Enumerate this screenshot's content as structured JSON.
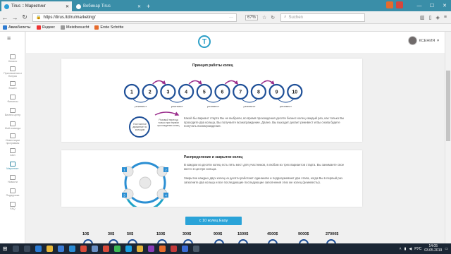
{
  "browser": {
    "tabs": [
      {
        "title": "Tirus :: Маркетинг",
        "active": true
      },
      {
        "title": "Вебинар Tirus",
        "active": false
      }
    ],
    "url": "https://tirus.ltd/ru/marketing/",
    "zoom": "67%",
    "search_placeholder": "Suchen",
    "bookmarks": [
      "Авиабилеты",
      "Яндекс",
      "Meistbesucht",
      "Erste Schritte"
    ]
  },
  "sidebar": {
    "menu_icon": "hamburger-icon",
    "items": [
      {
        "label": "Начало",
        "icon": "home-icon"
      },
      {
        "label": "Приглашения и бонусы",
        "icon": "gift-icon"
      },
      {
        "label": "Кошел",
        "icon": "wallet-icon"
      },
      {
        "label": "Финансы",
        "icon": "finance-icon"
      },
      {
        "label": "Бизнес центр",
        "icon": "business-icon"
      },
      {
        "label": "Мой команда",
        "icon": "team-icon"
      },
      {
        "label": "Инвестиции программы",
        "icon": "investment-icon"
      },
      {
        "label": "Шоп",
        "icon": "shop-icon"
      },
      {
        "label": "Маркетинг",
        "icon": "marketing-icon",
        "active": true
      },
      {
        "label": "Новости",
        "icon": "news-icon"
      },
      {
        "label": "Поддержка",
        "icon": "support-icon"
      },
      {
        "label": "FAQ",
        "icon": "faq-icon"
      }
    ]
  },
  "header": {
    "username": "КСЕНИЯ"
  },
  "section1": {
    "title": "Принцип работы колец",
    "rings": [
      "1",
      "2",
      "3",
      "4",
      "5",
      "6",
      "7",
      "8",
      "9",
      "10"
    ],
    "reinvest_label": "реинвест",
    "legend_rotation": "Постоянное движение по кольцам",
    "legend_transfer": "Разовый переход только при первом прохождении колец",
    "paragraph": "Какой бы вариант старта Вы не выбрали, во время прохождения десяти бизнес колец каждый раз, как только Вы проходите два кольца, Вы получаете вознаграждение. Далее, Вы выходит делает реинвест и Вы снова будете получать вознаграждение."
  },
  "section2": {
    "title": "Распределение и закрытие колец",
    "nodes": [
      "1",
      "2",
      "3",
      "4"
    ],
    "paragraph1": "В каждом из десяти колец есть пять мест для участников, в любом из трех вариантов старта. Вы занимаете свое место в центре кольца.",
    "paragraph2": "Закрытие каждых двух колец из десяти работают одинаково и подразумевают два этапа, когда Вы в первый раз заполните два кольца и все последующие последующие заполнения этих же колец (реинвесты)."
  },
  "cta": {
    "label": "с 10 колец Easy"
  },
  "prices": [
    "10$",
    "30$",
    "50$",
    "150$",
    "300$",
    "900$",
    "1500$",
    "4500$",
    "9000$",
    "27000$"
  ],
  "taskbar": {
    "time": "14:05",
    "date": "03.05.2019",
    "lang": "РУС"
  },
  "colors": {
    "accent": "#2aa3d8",
    "ring": "#1e4f97",
    "arrow": "#9a2d8c",
    "teal": "#3a8ea8"
  }
}
